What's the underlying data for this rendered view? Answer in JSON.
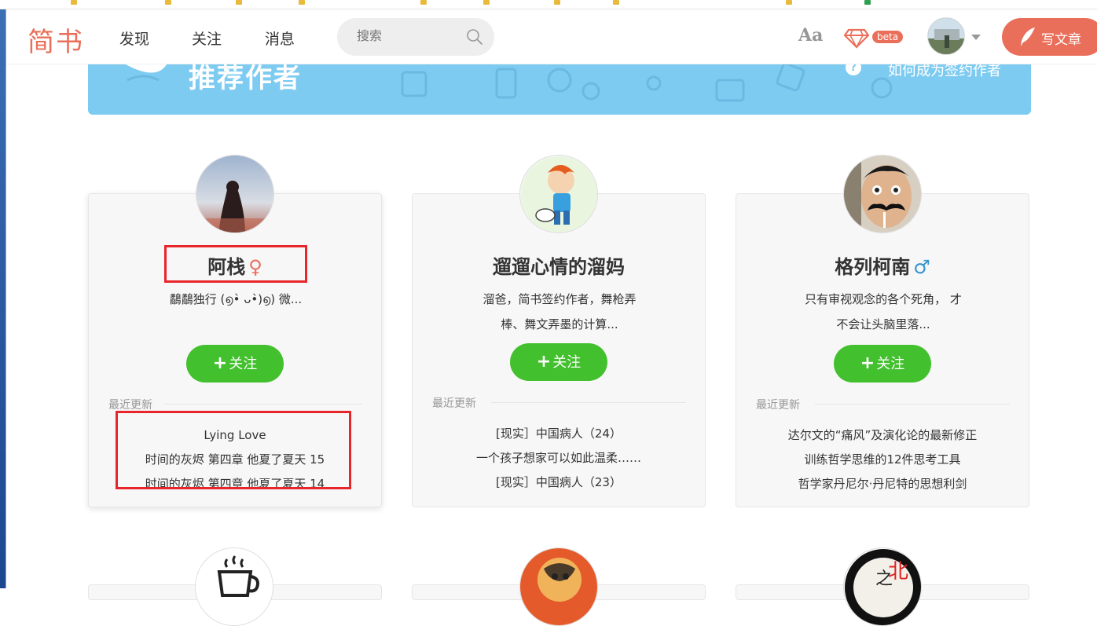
{
  "navbar": {
    "logo": "简书",
    "links": [
      "发现",
      "关注",
      "消息"
    ],
    "search_placeholder": "搜索",
    "font_toggle": "Aa",
    "beta_badge": "beta",
    "write_button": "写文章"
  },
  "banner": {
    "title": "推荐作者",
    "help_link": "如何成为签约作者"
  },
  "authors": [
    {
      "name": "阿栈",
      "gender_symbol": "♀",
      "description": "鷸鷸独行 (൭•̀ ᴗ•̀)൭) 微...",
      "follow_label": "关注",
      "recent_heading": "最近更新",
      "recent": [
        "Lying Love",
        "时间的灰烬 第四章 他夏了夏天 15",
        "时间的灰烬 第四章 他夏了夏天 14"
      ]
    },
    {
      "name": "遛遛心情的溜妈",
      "gender_symbol": "",
      "description_lines": [
        "溜爸，简书签约作者，舞枪弄",
        "棒、舞文弄墨的计算..."
      ],
      "follow_label": "关注",
      "recent_heading": "最近更新",
      "recent": [
        "[现实］中国病人（24）",
        "一个孩子想家可以如此温柔……",
        "[现实］中国病人（23）"
      ]
    },
    {
      "name": "格列柯南",
      "gender_symbol": "♂",
      "description_lines": [
        "只有审视观念的各个死角， 才",
        "不会让头脑里落..."
      ],
      "follow_label": "关注",
      "recent_heading": "最近更新",
      "recent": [
        "达尔文的“痛风”及演化论的最新修正",
        "训练哲学思维的12件思考工具",
        "哲学家丹尼尔·丹尼特的思想利剑"
      ]
    }
  ],
  "partial_avatar_text": "北 之",
  "colors": {
    "brand": "#ea6f5a",
    "follow_green": "#42c02e",
    "banner_blue": "#7ecbf1",
    "highlight_red": "#e8252b",
    "male_blue": "#3194d0"
  }
}
